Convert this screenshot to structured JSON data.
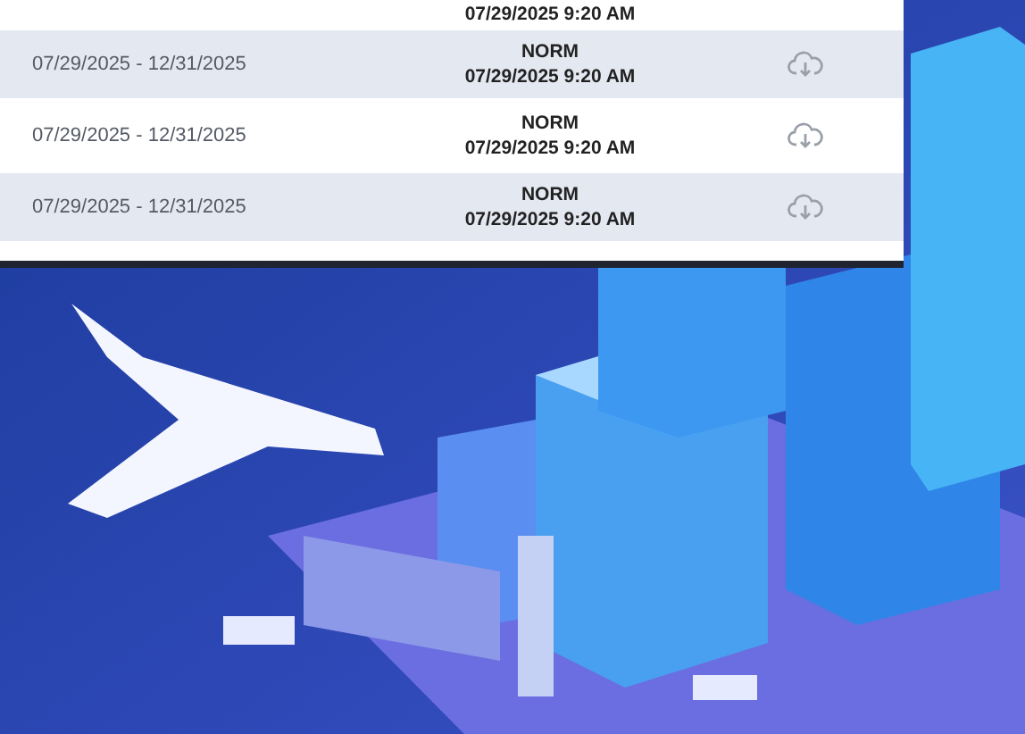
{
  "table": {
    "rows": [
      {
        "timestamp": "07/29/2025 9:20 AM"
      },
      {
        "date_range": "07/29/2025 - 12/31/2025",
        "status": "NORM",
        "timestamp": "07/29/2025 9:20 AM"
      },
      {
        "date_range": "07/29/2025 - 12/31/2025",
        "status": "NORM",
        "timestamp": "07/29/2025 9:20 AM"
      },
      {
        "date_range": "07/29/2025 - 12/31/2025",
        "status": "NORM",
        "timestamp": "07/29/2025 9:20 AM"
      }
    ]
  }
}
